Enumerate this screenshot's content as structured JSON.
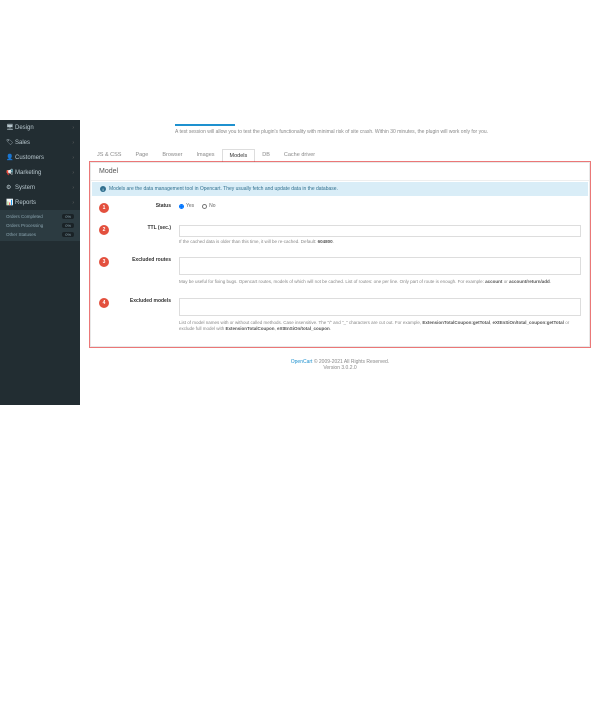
{
  "sidebar": {
    "items": [
      {
        "icon": "🖥",
        "label": "Design"
      },
      {
        "icon": "🏷",
        "label": "Sales"
      },
      {
        "icon": "👤",
        "label": "Customers"
      },
      {
        "icon": "📢",
        "label": "Marketing"
      },
      {
        "icon": "⚙",
        "label": "System"
      },
      {
        "icon": "📊",
        "label": "Reports"
      }
    ],
    "sub": [
      {
        "label": "Orders Completed",
        "badge": "0%"
      },
      {
        "label": "Orders Processing",
        "badge": "0%"
      },
      {
        "label": "Other Statuses",
        "badge": "0%"
      }
    ]
  },
  "session": {
    "text": "A test session will allow you to test the plugin's functionality with minimal risk of site crash. Within 30 minutes, the plugin will work only for you."
  },
  "tabs": [
    "JS & CSS",
    "Page",
    "Browser",
    "Images",
    "Models",
    "DB",
    "Cache driver"
  ],
  "active_tab": 4,
  "panel": {
    "title": "Model",
    "alert": "Models are the data management tool in Opencart. They usually fetch and update data in the database.",
    "fields": [
      {
        "n": "1",
        "label": "Status",
        "type": "radio",
        "opts": [
          {
            "label": "Yes",
            "checked": true
          },
          {
            "label": "No",
            "checked": false
          }
        ]
      },
      {
        "n": "2",
        "label": "TTL (sec.)",
        "type": "text",
        "value": "",
        "help": "If the cached data is older than this time, it will be re-cached. Default: <b>604800</b>."
      },
      {
        "n": "3",
        "label": "Excluded routes",
        "type": "textarea",
        "value": "",
        "help": "May be useful for fixing bugs. Opencart routes, models of which will not be cached. List of routes: one per line. Only part of route is enough. For example: <b>account</b> or <b>account/return/add</b>."
      },
      {
        "n": "4",
        "label": "Excluded models",
        "type": "textarea",
        "value": "",
        "help": "List of model names with or without called methods. Case insensitive. The \"/\" and \"_\" characters are cut out. For example, <b>ExtensionTotalCoupon:getTotal</b>, <b>eXtEnSiOn/total_coupon:getTotal</b> or exclude full model with <b>ExtensionTotalCoupon</b>, <b>eXtEnSiOn/total_coupon</b>."
      }
    ]
  },
  "footer": {
    "brand": "OpenCart",
    "copy": " © 2009-2021 All Rights Reserved.",
    "ver": "Version 3.0.2.0"
  }
}
